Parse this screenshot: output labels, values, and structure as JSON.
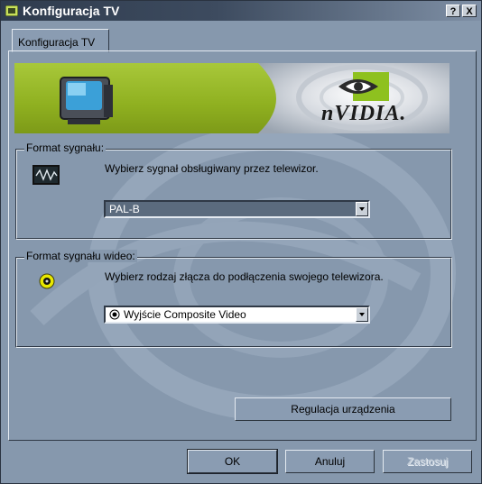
{
  "window": {
    "title": "Konfiguracja TV",
    "help_label": "?",
    "close_label": "X"
  },
  "tabs": [
    {
      "label": "Konfiguracja TV"
    }
  ],
  "banner": {
    "brand_text": "nVIDIA."
  },
  "signal_group": {
    "title": "Format sygnału:",
    "description": "Wybierz sygnał obsługiwany przez telewizor.",
    "selected_value": "PAL-B",
    "icon": "waveform-icon"
  },
  "video_group": {
    "title": "Format sygnału wideo:",
    "description": "Wybierz rodzaj złącza do podłączenia swojego telewizora.",
    "selected_value": "Wyjście Composite Video",
    "icon": "composite-connector-icon"
  },
  "buttons": {
    "device_settings": "Regulacja urządzenia",
    "ok": "OK",
    "cancel": "Anuluj",
    "apply": "Zastosuj"
  },
  "colors": {
    "dialog_bg": "#8698ad",
    "banner_green": "#9ebf2e",
    "connector_yellow": "#e8e800"
  }
}
